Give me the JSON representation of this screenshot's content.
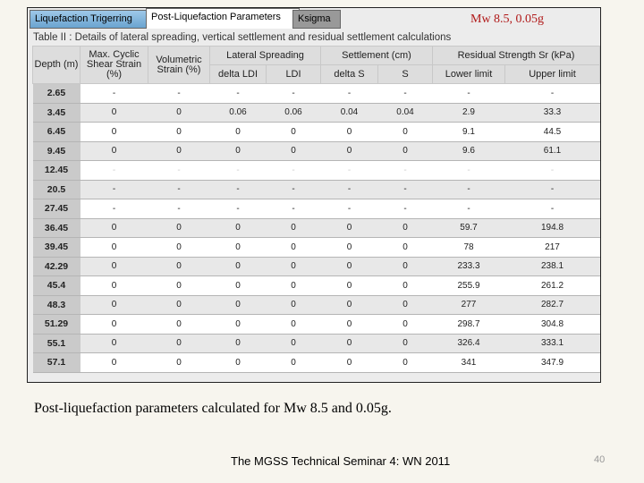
{
  "tabs": [
    "Liquefaction Trigerring",
    "Post-Liquefaction Parameters",
    "Ksigma"
  ],
  "annotation": "Mw 8.5, 0.05g",
  "caption": "Table II : Details of lateral spreading, vertical settlement and residual settlement calculations",
  "headers": {
    "depth": "Depth (m)",
    "max_cyclic": "Max. Cyclic Shear Strain (%)",
    "volumetric": "Volumetric Strain (%)",
    "lateral": "Lateral Spreading",
    "settlement": "Settlement (cm)",
    "residual": "Residual Strength Sr (kPa)",
    "delta_ldi": "delta LDI",
    "ldi": "LDI",
    "delta_s": "delta S",
    "s": "S",
    "lower": "Lower limit",
    "upper": "Upper limit"
  },
  "rows": [
    [
      "2.65",
      "-",
      "-",
      "-",
      "-",
      "-",
      "-",
      "-",
      "-"
    ],
    [
      "3.45",
      "0",
      "0",
      "0.06",
      "0.06",
      "0.04",
      "0.04",
      "2.9",
      "33.3"
    ],
    [
      "6.45",
      "0",
      "0",
      "0",
      "0",
      "0",
      "0",
      "9.1",
      "44.5"
    ],
    [
      "9.45",
      "0",
      "0",
      "0",
      "0",
      "0",
      "0",
      "9.6",
      "61.1"
    ],
    [
      "12.45",
      "-",
      "-",
      "-",
      "-",
      "-",
      "-",
      "-",
      "-"
    ],
    [
      "20.5",
      "-",
      "-",
      "-",
      "-",
      "-",
      "-",
      "-",
      "-"
    ],
    [
      "27.45",
      "-",
      "-",
      "-",
      "-",
      "-",
      "-",
      "-",
      "-"
    ],
    [
      "36.45",
      "0",
      "0",
      "0",
      "0",
      "0",
      "0",
      "59.7",
      "194.8"
    ],
    [
      "39.45",
      "0",
      "0",
      "0",
      "0",
      "0",
      "0",
      "78",
      "217"
    ],
    [
      "42.29",
      "0",
      "0",
      "0",
      "0",
      "0",
      "0",
      "233.3",
      "238.1"
    ],
    [
      "45.4",
      "0",
      "0",
      "0",
      "0",
      "0",
      "0",
      "255.9",
      "261.2"
    ],
    [
      "48.3",
      "0",
      "0",
      "0",
      "0",
      "0",
      "0",
      "277",
      "282.7"
    ],
    [
      "51.29",
      "0",
      "0",
      "0",
      "0",
      "0",
      "0",
      "298.7",
      "304.8"
    ],
    [
      "55.1",
      "0",
      "0",
      "0",
      "0",
      "0",
      "0",
      "326.4",
      "333.1"
    ],
    [
      "57.1",
      "0",
      "0",
      "0",
      "0",
      "0",
      "0",
      "341",
      "347.9"
    ]
  ],
  "slide_caption": "Post-liquefaction parameters calculated for Mw 8.5 and 0.05g.",
  "footer": "The MGSS Technical Seminar 4: WN 2011",
  "page_number": "40"
}
